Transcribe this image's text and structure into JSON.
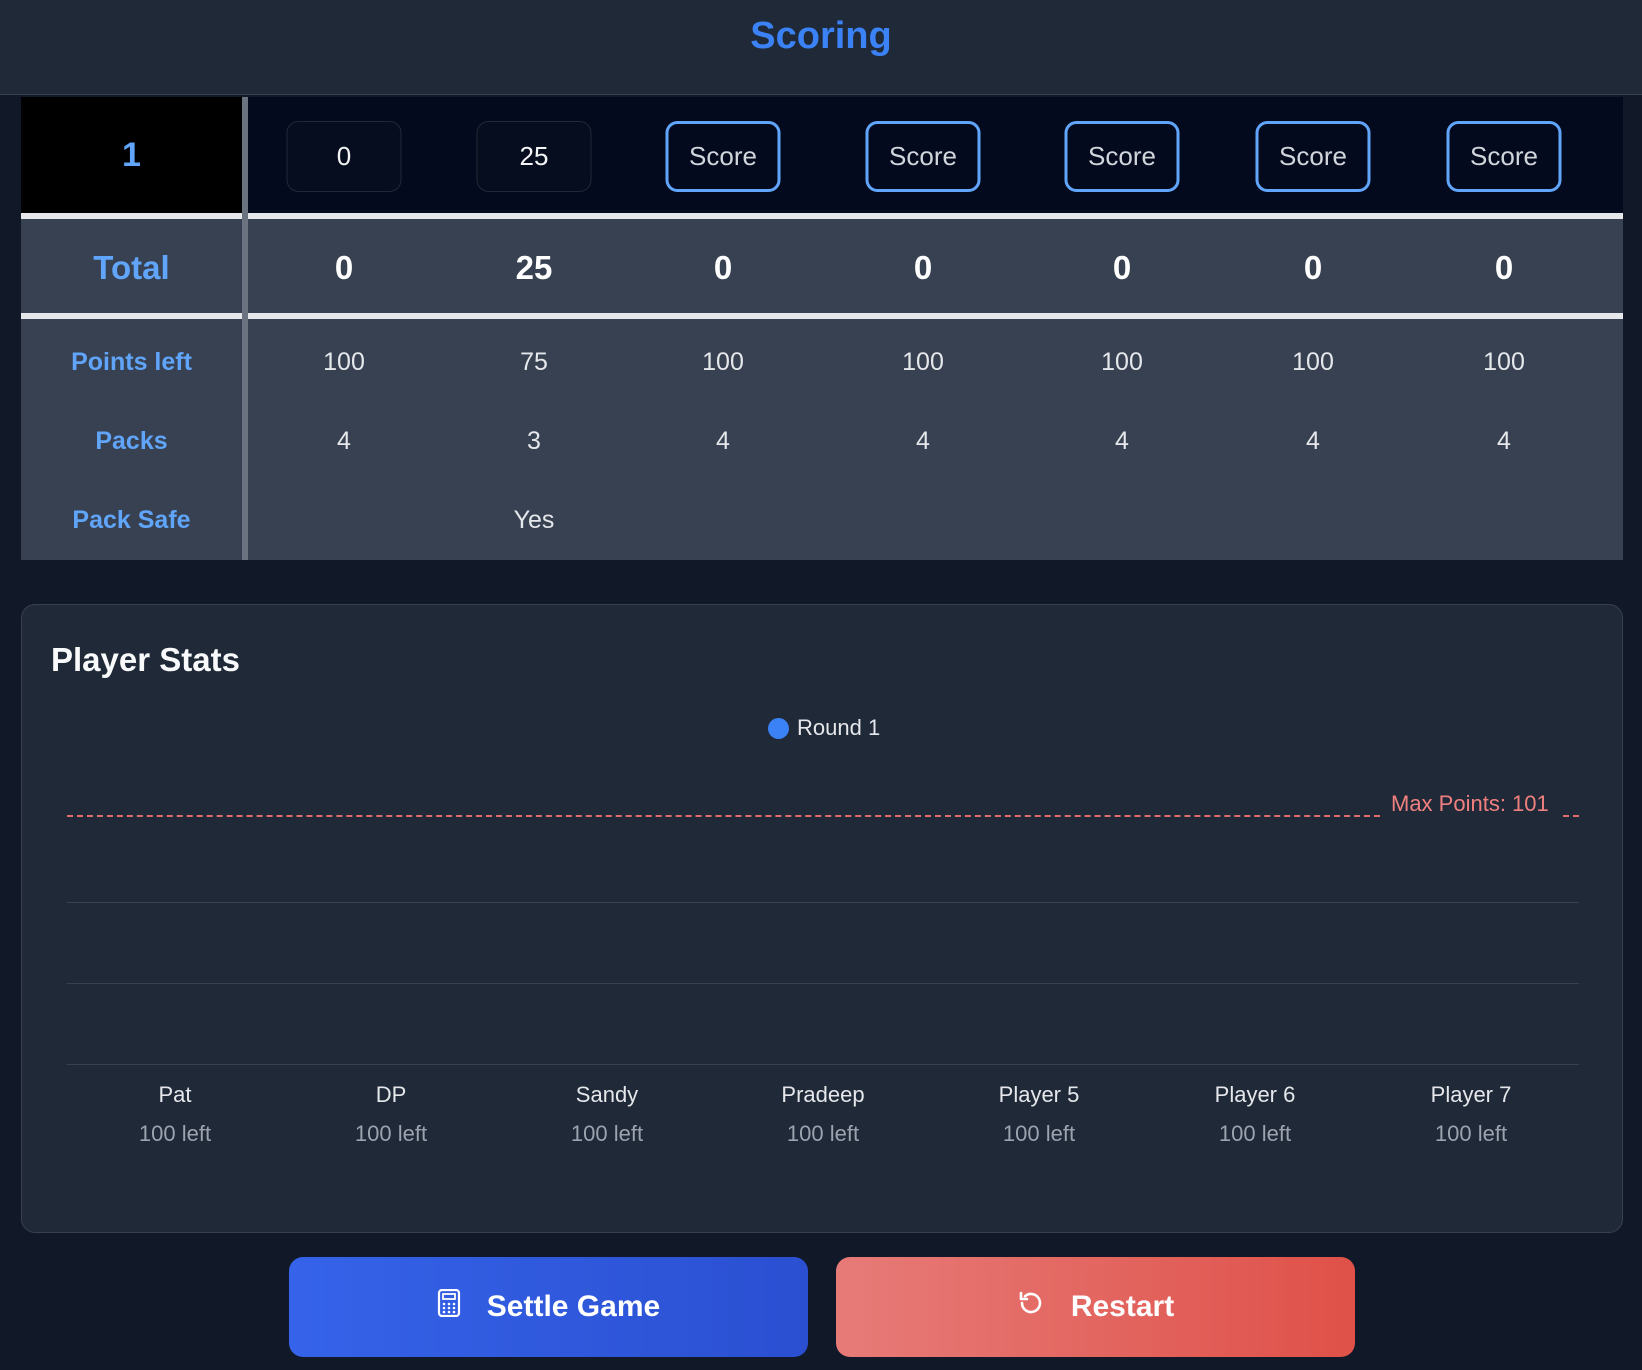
{
  "header": {
    "title": "Scoring"
  },
  "table": {
    "round_number": "1",
    "score_inputs": [
      {
        "value": "0",
        "filled": true
      },
      {
        "value": "25",
        "filled": true
      },
      {
        "value": "Score",
        "filled": false
      },
      {
        "value": "Score",
        "filled": false
      },
      {
        "value": "Score",
        "filled": false
      },
      {
        "value": "Score",
        "filled": false
      },
      {
        "value": "Score",
        "filled": false
      }
    ],
    "total_label": "Total",
    "totals": [
      "0",
      "25",
      "0",
      "0",
      "0",
      "0",
      "0"
    ],
    "points_left_label": "Points left",
    "points_left": [
      "100",
      "75",
      "100",
      "100",
      "100",
      "100",
      "100"
    ],
    "packs_label": "Packs",
    "packs": [
      "4",
      "3",
      "4",
      "4",
      "4",
      "4",
      "4"
    ],
    "pack_safe_label": "Pack Safe",
    "pack_safe": [
      "",
      "Yes",
      "",
      "",
      "",
      "",
      ""
    ]
  },
  "stats": {
    "title": "Player Stats",
    "legend": "Round 1",
    "max_label": "Max Points: 101",
    "players": [
      {
        "name": "Pat",
        "left": "100 left"
      },
      {
        "name": "DP",
        "left": "100 left"
      },
      {
        "name": "Sandy",
        "left": "100 left"
      },
      {
        "name": "Pradeep",
        "left": "100 left"
      },
      {
        "name": "Player 5",
        "left": "100 left"
      },
      {
        "name": "Player 6",
        "left": "100 left"
      },
      {
        "name": "Player 7",
        "left": "100 left"
      }
    ]
  },
  "chart_data": {
    "type": "bar",
    "categories": [
      "Pat",
      "DP",
      "Sandy",
      "Pradeep",
      "Player 5",
      "Player 6",
      "Player 7"
    ],
    "series": [
      {
        "name": "Round 1",
        "values": [
          0,
          0,
          0,
          0,
          0,
          0,
          0
        ]
      }
    ],
    "annotations": [
      "Max Points: 101"
    ],
    "colors": {
      "round1": "#3b82f6",
      "max_line": "#e06b6b"
    }
  },
  "actions": {
    "settle_label": "Settle Game",
    "settle_icon": "calculator-icon",
    "restart_label": "Restart",
    "restart_icon": "restart-icon"
  }
}
